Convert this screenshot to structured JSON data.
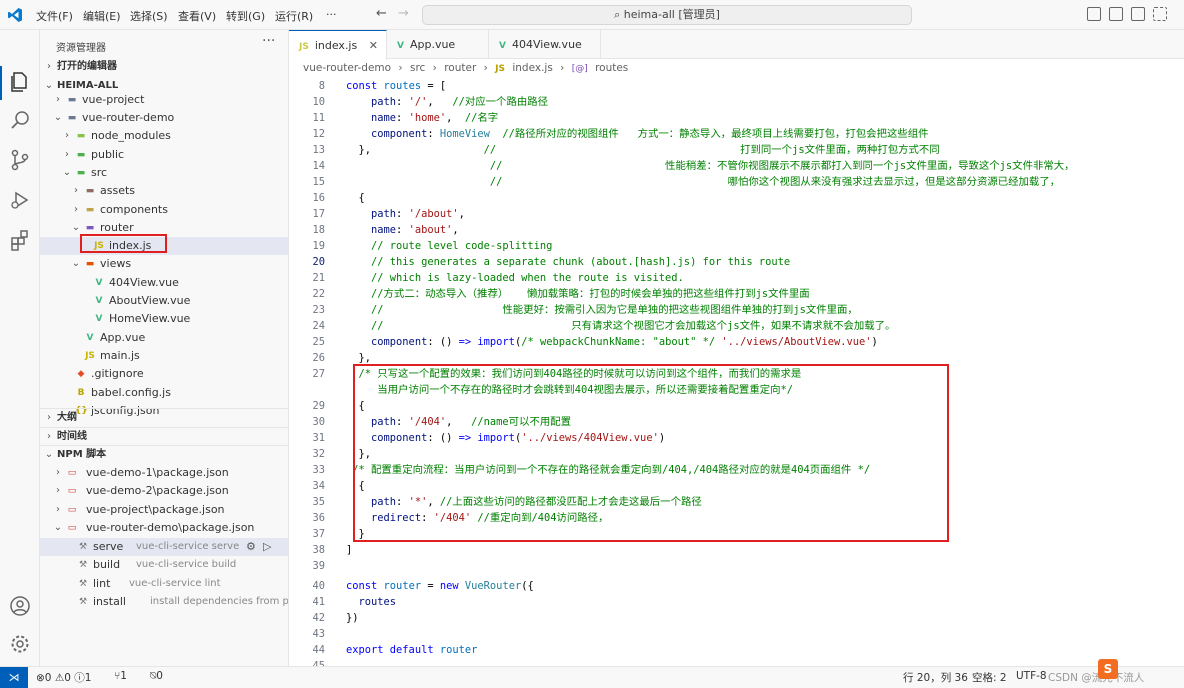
{
  "titlebar": {
    "menus": [
      "文件(F)",
      "编辑(E)",
      "选择(S)",
      "查看(V)",
      "转到(G)",
      "运行(R)",
      "···"
    ],
    "search_text": "heima-all [管理员]"
  },
  "sidebar": {
    "title": "资源管理器",
    "more": "···",
    "open_editors": "打开的编辑器",
    "workspace": "HEIMA-ALL",
    "tree": [
      {
        "label": "vue-project",
        "depth": 1,
        "chev": "›",
        "icon": "folder"
      },
      {
        "label": "vue-router-demo",
        "depth": 1,
        "chev": "⌄",
        "icon": "folder"
      },
      {
        "label": "node_modules",
        "depth": 2,
        "chev": "›",
        "icon": "folder-node"
      },
      {
        "label": "public",
        "depth": 2,
        "chev": "›",
        "icon": "folder-public"
      },
      {
        "label": "src",
        "depth": 2,
        "chev": "⌄",
        "icon": "folder-src"
      },
      {
        "label": "assets",
        "depth": 3,
        "chev": "›",
        "icon": "folder-assets"
      },
      {
        "label": "components",
        "depth": 3,
        "chev": "›",
        "icon": "folder-components"
      },
      {
        "label": "router",
        "depth": 3,
        "chev": "⌄",
        "icon": "folder-router"
      },
      {
        "label": "index.js",
        "depth": 4,
        "chev": "",
        "icon": "js",
        "selected": true
      },
      {
        "label": "views",
        "depth": 3,
        "chev": "⌄",
        "icon": "folder-views"
      },
      {
        "label": "404View.vue",
        "depth": 4,
        "chev": "",
        "icon": "vue"
      },
      {
        "label": "AboutView.vue",
        "depth": 4,
        "chev": "",
        "icon": "vue"
      },
      {
        "label": "HomeView.vue",
        "depth": 4,
        "chev": "",
        "icon": "vue"
      },
      {
        "label": "App.vue",
        "depth": 3,
        "chev": "",
        "icon": "vue"
      },
      {
        "label": "main.js",
        "depth": 3,
        "chev": "",
        "icon": "js"
      },
      {
        "label": ".gitignore",
        "depth": 2,
        "chev": "",
        "icon": "git"
      },
      {
        "label": "babel.config.js",
        "depth": 2,
        "chev": "",
        "icon": "babel"
      },
      {
        "label": "jsconfig.json",
        "depth": 2,
        "chev": "",
        "icon": "json"
      }
    ],
    "outline": "大纲",
    "timeline": "时间线",
    "npm_scripts": "NPM 脚本",
    "npm": [
      {
        "label": "vue-demo-1\\package.json",
        "chev": "›"
      },
      {
        "label": "vue-demo-2\\package.json",
        "chev": "›"
      },
      {
        "label": "vue-project\\package.json",
        "chev": "›"
      },
      {
        "label": "vue-router-demo\\package.json",
        "chev": "⌄"
      }
    ],
    "scripts": [
      {
        "name": "serve",
        "cmd": "vue-cli-service serve",
        "icon": "wrench"
      },
      {
        "name": "build",
        "cmd": "vue-cli-service build",
        "icon": "wrench"
      },
      {
        "name": "lint",
        "cmd": "vue-cli-service lint",
        "icon": "wrench"
      },
      {
        "name": "install",
        "cmd": "install dependencies from packa...",
        "icon": "wrench"
      }
    ]
  },
  "tabs": [
    {
      "label": "index.js",
      "icon": "JS",
      "active": true,
      "close": "✕"
    },
    {
      "label": "App.vue",
      "icon": "V",
      "active": false
    },
    {
      "label": "404View.vue",
      "icon": "V",
      "active": false
    }
  ],
  "breadcrumb": [
    "vue-router-demo",
    "›",
    "src",
    "›",
    "router",
    "›",
    "JS",
    "index.js",
    "›",
    "[@]",
    "routes"
  ],
  "editor": {
    "current_line": 20,
    "lines": [
      {
        "n": 8,
        "code": [
          [
            "k",
            "const "
          ],
          [
            "v",
            "routes"
          ],
          [
            "o",
            " = ["
          ]
        ]
      },
      {
        "n": 10,
        "code": [
          [
            "p",
            "    path"
          ],
          [
            "o",
            ": "
          ],
          [
            "s",
            "'/'"
          ],
          [
            "o",
            ",   "
          ],
          [
            "c",
            "//对应一个路由路径"
          ]
        ]
      },
      {
        "n": 11,
        "code": [
          [
            "p",
            "    name"
          ],
          [
            "o",
            ": "
          ],
          [
            "s",
            "'home'"
          ],
          [
            "o",
            ",  "
          ],
          [
            "c",
            "//名字"
          ]
        ]
      },
      {
        "n": 12,
        "code": [
          [
            "p",
            "    component"
          ],
          [
            "o",
            ": "
          ],
          [
            "t",
            "HomeView"
          ],
          [
            "c",
            "  //路径所对应的视图组件   方式一：静态导入，最终项目上线需要打包，打包会把这些组件"
          ]
        ]
      },
      {
        "n": 13,
        "code": [
          [
            "o",
            "  },                  "
          ],
          [
            "c",
            "//                                       打到同一个js文件里面，两种打包方式不同"
          ]
        ]
      },
      {
        "n": 14,
        "code": [
          [
            "o",
            "                       "
          ],
          [
            "c",
            "//                          性能稍差：不管你视图展示不展示都打入到同一个js文件里面，导致这个js文件非常大，"
          ]
        ]
      },
      {
        "n": 15,
        "code": [
          [
            "o",
            "                       "
          ],
          [
            "c",
            "//                                    哪怕你这个视图从来没有强求过去显示过，但是这部分资源已经加载了，"
          ]
        ]
      },
      {
        "n": 16,
        "code": [
          [
            "o",
            "  {"
          ]
        ]
      },
      {
        "n": 17,
        "code": [
          [
            "p",
            "    path"
          ],
          [
            "o",
            ": "
          ],
          [
            "s",
            "'/about'"
          ],
          [
            "o",
            ","
          ]
        ]
      },
      {
        "n": 18,
        "code": [
          [
            "p",
            "    name"
          ],
          [
            "o",
            ": "
          ],
          [
            "s",
            "'about'"
          ],
          [
            "o",
            ","
          ]
        ]
      },
      {
        "n": 19,
        "code": [
          [
            "c",
            "    // route level code-splitting"
          ]
        ]
      },
      {
        "n": 20,
        "code": [
          [
            "c",
            "    // this generates a separate chunk (about.[hash].js) for this route"
          ]
        ]
      },
      {
        "n": 21,
        "code": [
          [
            "c",
            "    // which is lazy-loaded when the route is visited."
          ]
        ]
      },
      {
        "n": 22,
        "code": [
          [
            "c",
            "    //方式二：动态导入（推荐）   懒加载策略：打包的时候会单独的把这些组件打到js文件里面"
          ]
        ]
      },
      {
        "n": 23,
        "code": [
          [
            "c",
            "    //                   性能更好：按需引入因为它是单独的把这些视图组件单独的打到js文件里面，"
          ]
        ]
      },
      {
        "n": 24,
        "code": [
          [
            "c",
            "    //                              只有请求这个视图它才会加载这个js文件，如果不请求就不会加载了。"
          ]
        ]
      },
      {
        "n": 25,
        "code": [
          [
            "p",
            "    component"
          ],
          [
            "o",
            ": () "
          ],
          [
            "k",
            "=>"
          ],
          [
            "o",
            " "
          ],
          [
            "k",
            "import"
          ],
          [
            "o",
            "("
          ],
          [
            "c",
            "/* webpackChunkName: \"about\" */"
          ],
          [
            "o",
            " "
          ],
          [
            "s",
            "'../views/AboutView.vue'"
          ],
          [
            "o",
            ")"
          ]
        ]
      },
      {
        "n": 26,
        "code": [
          [
            "o",
            "  },"
          ]
        ]
      },
      {
        "n": 27,
        "code": [
          [
            "c",
            "  /* 只写这一个配置的效果：我们访问到404路径的时候就可以访问到这个组件，而我们的需求是"
          ]
        ]
      },
      {
        "n": "",
        "code": [
          [
            "c",
            "     当用户访问一个不存在的路径时才会跳转到404视图去展示，所以还需要接着配置重定向*/"
          ]
        ]
      },
      {
        "n": 29,
        "code": [
          [
            "o",
            "  {"
          ]
        ]
      },
      {
        "n": 30,
        "code": [
          [
            "p",
            "    path"
          ],
          [
            "o",
            ": "
          ],
          [
            "s",
            "'/404'"
          ],
          [
            "o",
            ",   "
          ],
          [
            "c",
            "//name可以不用配置"
          ]
        ]
      },
      {
        "n": 31,
        "code": [
          [
            "p",
            "    component"
          ],
          [
            "o",
            ": () "
          ],
          [
            "k",
            "=>"
          ],
          [
            "o",
            " "
          ],
          [
            "k",
            "import"
          ],
          [
            "o",
            "("
          ],
          [
            "s",
            "'../views/404View.vue'"
          ],
          [
            "o",
            ")"
          ]
        ]
      },
      {
        "n": 32,
        "code": [
          [
            "o",
            "  },"
          ]
        ]
      },
      {
        "n": 33,
        "code": [
          [
            "c",
            " /* 配置重定向流程：当用户访问到一个不存在的路径就会重定向到/404,/404路径对应的就是404页面组件 */"
          ]
        ]
      },
      {
        "n": 34,
        "code": [
          [
            "o",
            "  {"
          ]
        ]
      },
      {
        "n": 35,
        "code": [
          [
            "p",
            "    path"
          ],
          [
            "o",
            ": "
          ],
          [
            "s",
            "'*'"
          ],
          [
            "o",
            ", "
          ],
          [
            "c",
            "//上面这些访问的路径都没匹配上才会走这最后一个路径"
          ]
        ]
      },
      {
        "n": 36,
        "code": [
          [
            "p",
            "    redirect"
          ],
          [
            "o",
            ": "
          ],
          [
            "s",
            "'/404'"
          ],
          [
            "o",
            " "
          ],
          [
            "c",
            "//重定向到/404访问路径，"
          ]
        ]
      },
      {
        "n": 37,
        "code": [
          [
            "o",
            "  }"
          ]
        ]
      },
      {
        "n": 38,
        "code": [
          [
            "o",
            "]"
          ]
        ]
      },
      {
        "n": 39,
        "code": []
      },
      {
        "n": 40,
        "code": [
          [
            "k",
            "const "
          ],
          [
            "v",
            "router"
          ],
          [
            "o",
            " = "
          ],
          [
            "k",
            "new "
          ],
          [
            "t",
            "VueRouter"
          ],
          [
            "o",
            "({"
          ]
        ]
      },
      {
        "n": 41,
        "code": [
          [
            "p",
            "  routes"
          ]
        ]
      },
      {
        "n": 42,
        "code": [
          [
            "o",
            "})"
          ]
        ]
      },
      {
        "n": 43,
        "code": []
      },
      {
        "n": 44,
        "code": [
          [
            "k",
            "export default "
          ],
          [
            "v",
            "router"
          ]
        ]
      },
      {
        "n": 45,
        "code": []
      }
    ]
  },
  "status": {
    "remote": "⋊",
    "problems": "⊗0 ⚠0 ⓘ1",
    "ports": "⑂1",
    "radio": "⍉0",
    "cursor": "行 20，列 36",
    "spaces": "空格: 2",
    "encoding": "UTF-8",
    "watermark": "CSDN @流光不流人"
  },
  "colors": {
    "accent": "#005fb8",
    "highlight_box": "#e02020"
  }
}
